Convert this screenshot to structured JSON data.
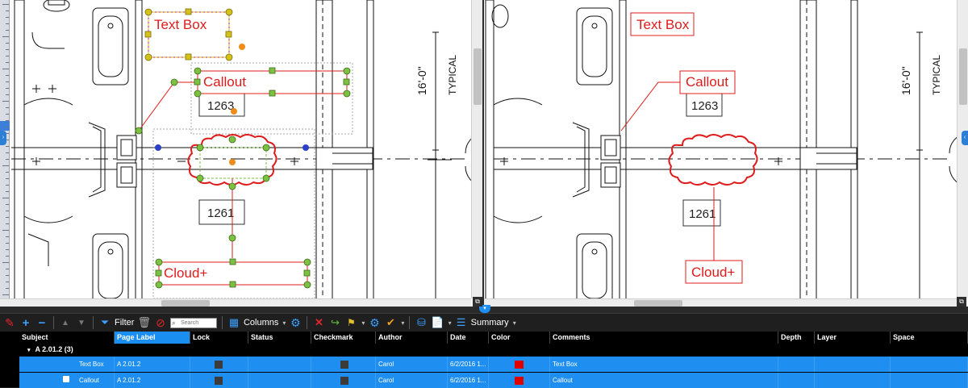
{
  "labels": {
    "text_box": "Text Box",
    "callout": "Callout",
    "cloud_plus": "Cloud+",
    "room_1263": "1263",
    "room_1261": "1261",
    "dimension": "16'-0\"",
    "typical": "TYPICAL"
  },
  "toolbar": {
    "filter_label": "Filter",
    "search_placeholder": "Search",
    "columns_label": "Columns",
    "summary_label": "Summary"
  },
  "columns": [
    "Subject",
    "Page Label",
    "Lock",
    "Status",
    "Checkmark",
    "Author",
    "Date",
    "Color",
    "Comments",
    "Depth",
    "Layer",
    "Space"
  ],
  "group": {
    "label": "A 2.01.2 (3)"
  },
  "rows": [
    {
      "subject": "Text Box",
      "page_label": "A 2.01.2",
      "author": "Carol",
      "date": "6/2/2016 1...",
      "color": "#e00000",
      "comments": "Text Box"
    },
    {
      "subject": "Callout",
      "page_label": "A 2.01.2",
      "author": "Carol",
      "date": "6/2/2016 1...",
      "color": "#e00000",
      "comments": "Callout"
    }
  ],
  "colors": {
    "markup_red": "#e01b1b",
    "selection_green": "#7cc242",
    "selection_yellow": "#d4c21a",
    "handle_orange": "#f08c1a",
    "handle_blue": "#2b3fc7",
    "accent_blue": "#1f8ef1"
  }
}
